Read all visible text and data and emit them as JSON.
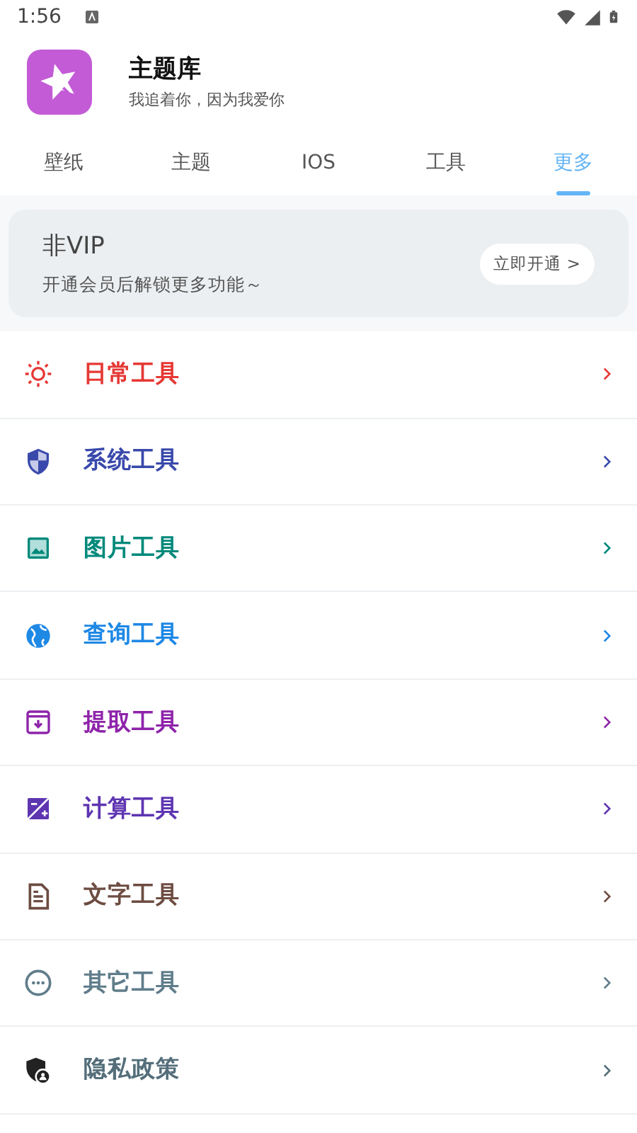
{
  "status_bar": {
    "time": "1:56"
  },
  "app": {
    "title": "主题库",
    "subtitle": "我追着你，因为我爱你"
  },
  "tabs": [
    {
      "label": "壁纸",
      "selected": false
    },
    {
      "label": "主题",
      "selected": false
    },
    {
      "label": "IOS",
      "selected": false
    },
    {
      "label": "工具",
      "selected": false
    },
    {
      "label": "更多",
      "selected": true
    }
  ],
  "vip_card": {
    "title": "非VIP",
    "subtitle": "开通会员后解锁更多功能～",
    "button": "立即开通 >"
  },
  "menu": [
    {
      "label": "日常工具",
      "color": "#e53935"
    },
    {
      "label": "系统工具",
      "color": "#3949ab"
    },
    {
      "label": "图片工具",
      "color": "#00897b"
    },
    {
      "label": "查询工具",
      "color": "#1e88e5"
    },
    {
      "label": "提取工具",
      "color": "#8e24aa"
    },
    {
      "label": "计算工具",
      "color": "#5e35b1"
    },
    {
      "label": "文字工具",
      "color": "#6d4c41"
    },
    {
      "label": "其它工具",
      "color": "#607d8b"
    },
    {
      "label": "隐私政策",
      "color": "#546e7a"
    }
  ]
}
